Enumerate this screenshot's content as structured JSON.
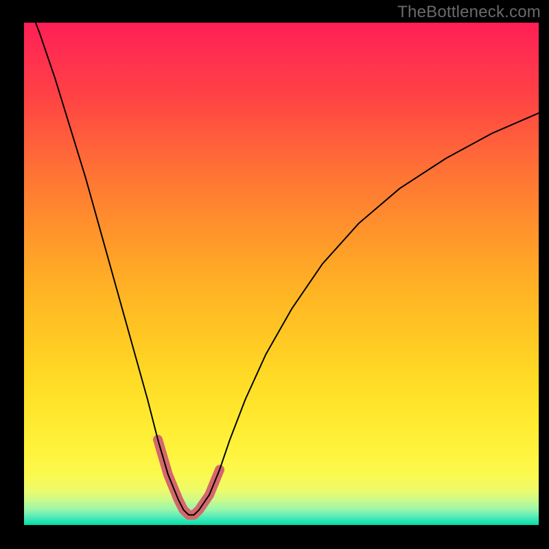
{
  "watermark": "TheBottleneck.com",
  "chart_data": {
    "type": "line",
    "title": "",
    "xlabel": "",
    "ylabel": "",
    "xlim": [
      0,
      100
    ],
    "ylim": [
      0,
      100
    ],
    "grid": false,
    "legend": false,
    "series": [
      {
        "name": "main-curve",
        "color": "#000000",
        "stroke_width": 2,
        "x": [
          0,
          3,
          6,
          9,
          12,
          15,
          18,
          21,
          24,
          26,
          28,
          30,
          31,
          32,
          33,
          34,
          36,
          38,
          40,
          43,
          47,
          52,
          58,
          65,
          73,
          82,
          91,
          100
        ],
        "values": [
          106,
          98,
          89,
          79,
          69,
          58,
          47,
          36,
          25,
          17,
          10,
          5,
          3,
          2,
          2,
          3,
          6,
          11,
          17,
          25,
          34,
          43,
          52,
          60,
          67,
          73,
          78,
          82
        ]
      },
      {
        "name": "highlight-band",
        "color": "#d4676c",
        "stroke_width": 14,
        "x": [
          26,
          28,
          30,
          31,
          32,
          33,
          34,
          36,
          38
        ],
        "values": [
          17,
          10,
          5,
          3,
          2,
          2,
          3,
          6,
          11
        ]
      }
    ],
    "background": {
      "type": "vertical-gradient",
      "stops": [
        {
          "pos": 0.0,
          "color": "#ff1f56"
        },
        {
          "pos": 0.3,
          "color": "#ff7335"
        },
        {
          "pos": 0.6,
          "color": "#ffc723"
        },
        {
          "pos": 0.85,
          "color": "#fff33c"
        },
        {
          "pos": 1.0,
          "color": "#00dfa8"
        }
      ]
    }
  }
}
